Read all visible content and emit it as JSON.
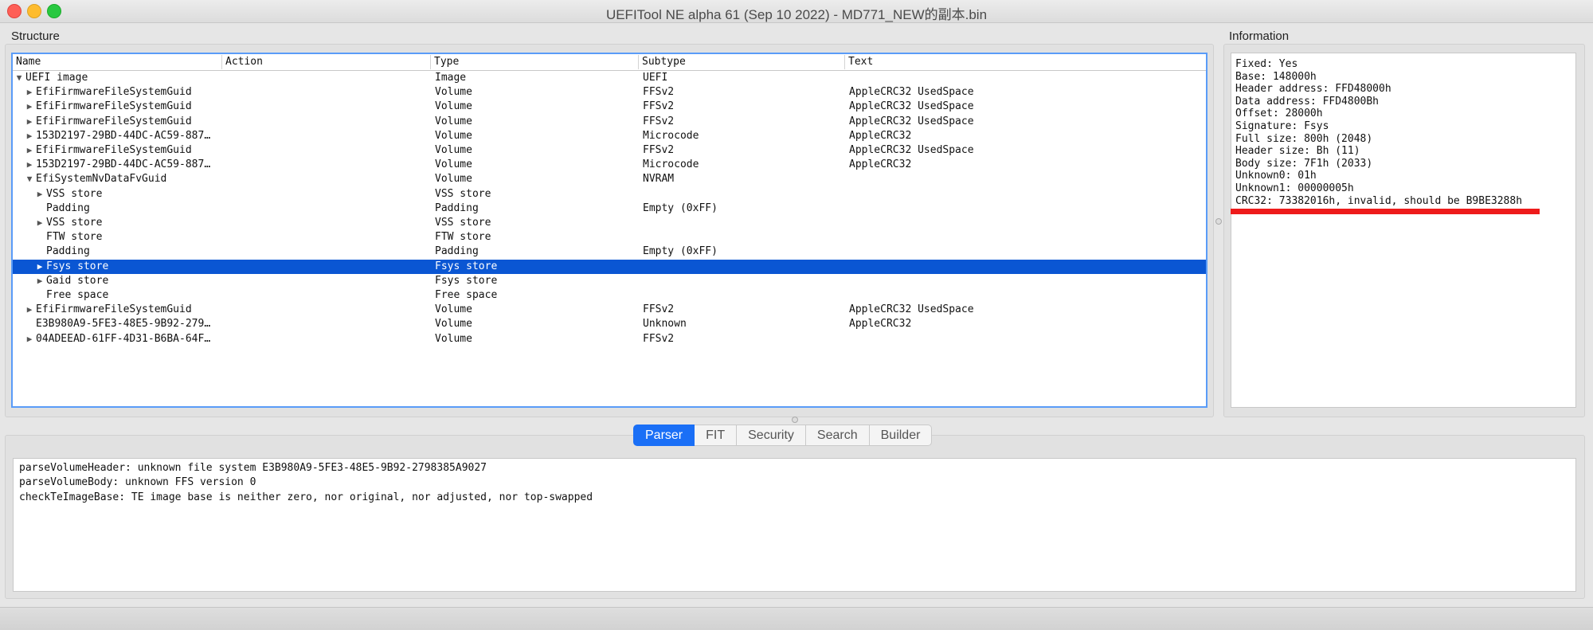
{
  "window": {
    "title": "UEFITool NE alpha 61 (Sep 10 2022) - MD771_NEW的副本.bin"
  },
  "structure": {
    "label": "Structure",
    "columns": [
      "Name",
      "Action",
      "Type",
      "Subtype",
      "Text"
    ],
    "rows": [
      {
        "indent": 0,
        "arrow": "down",
        "name": "UEFI image",
        "action": "",
        "type": "Image",
        "subtype": "UEFI",
        "text": ""
      },
      {
        "indent": 1,
        "arrow": "right",
        "name": "EfiFirmwareFileSystemGuid",
        "action": "",
        "type": "Volume",
        "subtype": "FFSv2",
        "text": "AppleCRC32 UsedSpace"
      },
      {
        "indent": 1,
        "arrow": "right",
        "name": "EfiFirmwareFileSystemGuid",
        "action": "",
        "type": "Volume",
        "subtype": "FFSv2",
        "text": "AppleCRC32 UsedSpace"
      },
      {
        "indent": 1,
        "arrow": "right",
        "name": "EfiFirmwareFileSystemGuid",
        "action": "",
        "type": "Volume",
        "subtype": "FFSv2",
        "text": "AppleCRC32 UsedSpace"
      },
      {
        "indent": 1,
        "arrow": "right",
        "name": "153D2197-29BD-44DC-AC59-887…",
        "action": "",
        "type": "Volume",
        "subtype": "Microcode",
        "text": "AppleCRC32"
      },
      {
        "indent": 1,
        "arrow": "right",
        "name": "EfiFirmwareFileSystemGuid",
        "action": "",
        "type": "Volume",
        "subtype": "FFSv2",
        "text": "AppleCRC32 UsedSpace"
      },
      {
        "indent": 1,
        "arrow": "right",
        "name": "153D2197-29BD-44DC-AC59-887…",
        "action": "",
        "type": "Volume",
        "subtype": "Microcode",
        "text": "AppleCRC32"
      },
      {
        "indent": 1,
        "arrow": "down",
        "name": "EfiSystemNvDataFvGuid",
        "action": "",
        "type": "Volume",
        "subtype": "NVRAM",
        "text": ""
      },
      {
        "indent": 2,
        "arrow": "right",
        "name": "VSS store",
        "action": "",
        "type": "VSS store",
        "subtype": "",
        "text": ""
      },
      {
        "indent": 2,
        "arrow": "",
        "name": "Padding",
        "action": "",
        "type": "Padding",
        "subtype": "Empty (0xFF)",
        "text": ""
      },
      {
        "indent": 2,
        "arrow": "right",
        "name": "VSS store",
        "action": "",
        "type": "VSS store",
        "subtype": "",
        "text": ""
      },
      {
        "indent": 2,
        "arrow": "",
        "name": "FTW store",
        "action": "",
        "type": "FTW store",
        "subtype": "",
        "text": ""
      },
      {
        "indent": 2,
        "arrow": "",
        "name": "Padding",
        "action": "",
        "type": "Padding",
        "subtype": "Empty (0xFF)",
        "text": ""
      },
      {
        "indent": 2,
        "arrow": "right",
        "name": "Fsys store",
        "action": "",
        "type": "Fsys store",
        "subtype": "",
        "text": "",
        "selected": true
      },
      {
        "indent": 2,
        "arrow": "right",
        "name": "Gaid store",
        "action": "",
        "type": "Fsys store",
        "subtype": "",
        "text": ""
      },
      {
        "indent": 2,
        "arrow": "",
        "name": "Free space",
        "action": "",
        "type": "Free space",
        "subtype": "",
        "text": ""
      },
      {
        "indent": 1,
        "arrow": "right",
        "name": "EfiFirmwareFileSystemGuid",
        "action": "",
        "type": "Volume",
        "subtype": "FFSv2",
        "text": "AppleCRC32 UsedSpace"
      },
      {
        "indent": 1,
        "arrow": "",
        "name": "E3B980A9-5FE3-48E5-9B92-279…",
        "action": "",
        "type": "Volume",
        "subtype": "Unknown",
        "text": "AppleCRC32"
      },
      {
        "indent": 1,
        "arrow": "right",
        "name": "04ADEEAD-61FF-4D31-B6BA-64F…",
        "action": "",
        "type": "Volume",
        "subtype": "FFSv2",
        "text": ""
      }
    ]
  },
  "information": {
    "label": "Information",
    "lines": [
      "Fixed: Yes",
      "Base: 148000h",
      "Header address: FFD48000h",
      "Data address: FFD4800Bh",
      "Offset: 28000h",
      "Signature: Fsys",
      "Full size: 800h (2048)",
      "Header size: Bh (11)",
      "Body size: 7F1h (2033)",
      "Unknown0: 01h",
      "Unknown1: 00000005h",
      "CRC32: 73382016h, invalid, should be B9BE3288h"
    ],
    "highlight_color": "#ee1b1b"
  },
  "tabs": [
    {
      "label": "Parser",
      "active": true
    },
    {
      "label": "FIT",
      "active": false
    },
    {
      "label": "Security",
      "active": false
    },
    {
      "label": "Search",
      "active": false
    },
    {
      "label": "Builder",
      "active": false
    }
  ],
  "messages": [
    "parseVolumeHeader: unknown file system E3B980A9-5FE3-48E5-9B92-2798385A9027",
    "parseVolumeBody: unknown FFS version 0",
    "checkTeImageBase: TE image base is neither zero, nor original, nor adjusted, nor top-swapped"
  ],
  "colors": {
    "selection": "#0a56d3",
    "active_tab": "#1a6ff6",
    "focus_border": "#5a9cf8"
  }
}
